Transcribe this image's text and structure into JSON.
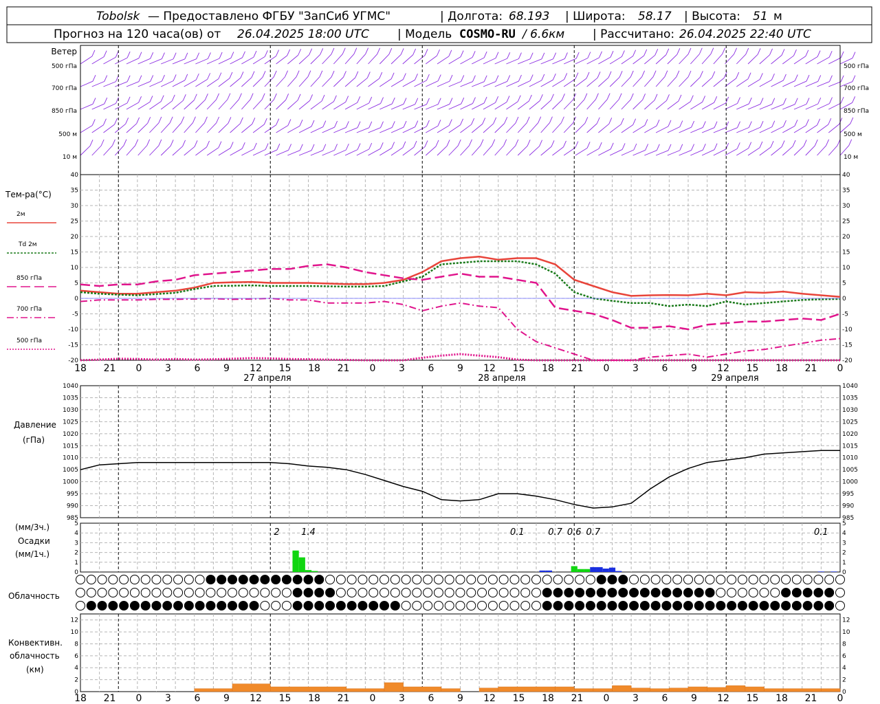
{
  "header": {
    "station": "Tobolsk",
    "line1_rest": "— Предоставлено ФГБУ \"ЗапСиб УГМС\"",
    "lon_label": "Долгота:",
    "lon_value": "68.193",
    "lat_label": "Широта:",
    "lat_value": "58.17",
    "alt_label": "Высота:",
    "alt_value": "51",
    "alt_unit": "м",
    "forecast_prefix": "Прогноз на 120 часа(ов) от",
    "forecast_start": "26.04.2025 18:00 UTC",
    "model_label": "Модель",
    "model_name": "COSMO-RU",
    "model_res": "/ 6.6км",
    "computed_label": "Рассчитано:",
    "computed_value": "26.04.2025 22:40 UTC"
  },
  "panels": {
    "wind": {
      "title": "Ветер",
      "levels": [
        "500 гПа",
        "700 гПа",
        "850 гПа",
        "500 м",
        "10 м"
      ],
      "color": "#8a2be2"
    },
    "temperature": {
      "title": "Тем-ра(°C)",
      "legend": [
        {
          "label": "2м",
          "color": "#e8443a",
          "style": "solid"
        },
        {
          "label": "Td 2м",
          "color": "#1a7a1a",
          "style": "dotted"
        },
        {
          "label": "850 гПа",
          "color": "#e0148c",
          "style": "solid"
        },
        {
          "label": "700 гПа",
          "color": "#e0148c",
          "style": "dash"
        },
        {
          "label": "500 гПа",
          "color": "#e0148c",
          "style": "dot"
        }
      ]
    },
    "pressure": {
      "title_line1": "Давление",
      "title_line2": "(гПа)"
    },
    "precip": {
      "units_top": "(мм/3ч.)",
      "title": "Осадки",
      "units_bottom": "(мм/1ч.)",
      "labels": [
        "2",
        "1.4",
        "0.1",
        "0.7",
        "0.6",
        "0.7",
        "0.1"
      ]
    },
    "cloud": {
      "title": "Облачность"
    },
    "convective": {
      "title_line1": "Конвективн.",
      "title_line2": "облачность",
      "title_line3": "(км)"
    }
  },
  "time_axis": {
    "ticks": [
      "18",
      "21",
      "0",
      "3",
      "6",
      "9",
      "12",
      "15",
      "18",
      "21",
      "0",
      "3",
      "6",
      "9",
      "12",
      "15",
      "18",
      "21",
      "0",
      "3",
      "6",
      "9",
      "12",
      "15",
      "18",
      "21",
      "0"
    ],
    "dates": [
      "27 апреля",
      "28 апреля",
      "29 апреля"
    ]
  },
  "colors": {
    "wind": "#8a2be2",
    "t2m": "#e8443a",
    "td": "#1a7a1a",
    "upper": "#e0148c",
    "precip_green": "#11d611",
    "precip_blue": "#1a2fe0",
    "conv": "#f08a2a"
  },
  "chart_data": [
    {
      "type": "line",
      "name": "temperature",
      "ylim": [
        -20,
        40
      ],
      "yticks": [
        -20,
        -15,
        -10,
        -5,
        0,
        5,
        10,
        15,
        20,
        25,
        30,
        35,
        40
      ],
      "x_hours": [
        0,
        3,
        6,
        9,
        12,
        15,
        18,
        21,
        24,
        27,
        30,
        33,
        36,
        39,
        42,
        45,
        48,
        51,
        54,
        57,
        60,
        63,
        66,
        69,
        72,
        75,
        78,
        81,
        84,
        87,
        90,
        93,
        96,
        99,
        102,
        105,
        108,
        111,
        114,
        117,
        120
      ],
      "series": [
        {
          "name": "2м",
          "values": [
            2.5,
            2,
            1.5,
            1.5,
            2,
            2.5,
            3.5,
            5,
            5.2,
            5.3,
            5,
            5,
            5,
            4.8,
            4.6,
            4.6,
            5,
            6,
            8.5,
            12,
            13,
            13.5,
            12.5,
            13,
            13,
            11,
            6,
            4,
            2,
            0.8,
            1,
            1.1,
            1,
            1.5,
            1,
            2,
            1.8,
            2.2,
            1.5,
            1,
            0.5
          ]
        },
        {
          "name": "Td 2м",
          "values": [
            2,
            1.5,
            1.2,
            1,
            1.4,
            1.8,
            3,
            4,
            4.1,
            4.2,
            4,
            4,
            4,
            3.9,
            3.8,
            3.8,
            4,
            5.5,
            7,
            11,
            11.5,
            12,
            12,
            12,
            11,
            8,
            2,
            0,
            -0.8,
            -1.5,
            -1.5,
            -2.5,
            -2,
            -2.5,
            -1,
            -2,
            -1.5,
            -1,
            -0.5,
            -0.3,
            -0.2
          ]
        },
        {
          "name": "850 гПа",
          "values": [
            4.5,
            4,
            4.5,
            4.5,
            5.5,
            6,
            7.5,
            8,
            8.5,
            9,
            9.5,
            9.5,
            10.5,
            11,
            10,
            8.5,
            7.5,
            6.5,
            6,
            7,
            8,
            7,
            7,
            6,
            5,
            -3,
            -4,
            -5,
            -7,
            -9.5,
            -9.5,
            -9,
            -10,
            -8.5,
            -8,
            -7.5,
            -7.5,
            -7,
            -6.5,
            -7,
            -5
          ]
        },
        {
          "name": "700 гПа",
          "values": [
            -1,
            -0.5,
            -0.5,
            -0.5,
            -0.3,
            -0.3,
            -0.2,
            -0.1,
            -0.3,
            -0.2,
            0,
            -0.5,
            -0.5,
            -1.5,
            -1.5,
            -1.5,
            -1,
            -2,
            -4,
            -2.5,
            -1.5,
            -2.5,
            -3,
            -10,
            -14,
            -16,
            -18,
            -20,
            -21,
            -20.5,
            -19,
            -18.5,
            -18,
            -19,
            -18,
            -17,
            -16.5,
            -15.5,
            -14.5,
            -13.5,
            -13
          ]
        },
        {
          "name": "500 гПа",
          "values": [
            -21,
            -19.8,
            -19.5,
            -19.6,
            -19.8,
            -19.6,
            -19.8,
            -19.7,
            -19.5,
            -19.3,
            -19.4,
            -19.6,
            -19.7,
            -19.8,
            -19.9,
            -20,
            -21,
            -20,
            -19.2,
            -18.5,
            -18,
            -18.5,
            -19,
            -19.8,
            -20,
            -20.5,
            -21,
            -21,
            -21,
            -21,
            -21,
            -21,
            -21,
            -21,
            -21,
            -21,
            -21,
            -21,
            -21,
            -21,
            -21
          ]
        }
      ]
    },
    {
      "type": "line",
      "name": "pressure",
      "ylim": [
        985,
        1040
      ],
      "yticks": [
        985,
        990,
        995,
        1000,
        1005,
        1010,
        1015,
        1020,
        1025,
        1030,
        1035,
        1040
      ],
      "x_hours": [
        0,
        3,
        6,
        9,
        12,
        15,
        18,
        21,
        24,
        27,
        30,
        33,
        36,
        39,
        42,
        45,
        48,
        51,
        54,
        57,
        60,
        63,
        66,
        69,
        72,
        75,
        78,
        81,
        84,
        87,
        90,
        93,
        96,
        99,
        102,
        105,
        108,
        111,
        114,
        117,
        120
      ],
      "values": [
        1005,
        1007,
        1007.5,
        1008,
        1008,
        1008,
        1008,
        1008,
        1008,
        1008,
        1008,
        1007.5,
        1006.5,
        1006,
        1005,
        1003,
        1000.5,
        998,
        996,
        992.5,
        992,
        992.5,
        995,
        995,
        994,
        992.5,
        990.5,
        989,
        989.5,
        991,
        997,
        1002,
        1005.5,
        1008,
        1009,
        1010,
        1011.5,
        1012,
        1012.5,
        1013,
        1013
      ]
    },
    {
      "type": "bar",
      "name": "precipitation",
      "ylim": [
        0,
        5
      ],
      "yticks": [
        0,
        1,
        2,
        3,
        4,
        5
      ],
      "bars": [
        {
          "hour": 34,
          "value": 2.2,
          "color": "green"
        },
        {
          "hour": 35,
          "value": 1.5,
          "color": "green"
        },
        {
          "hour": 36,
          "value": 0.2,
          "color": "green"
        },
        {
          "hour": 37,
          "value": 0.1,
          "color": "green"
        },
        {
          "hour": 73,
          "value": 0.15,
          "color": "blue"
        },
        {
          "hour": 74,
          "value": 0.15,
          "color": "blue"
        },
        {
          "hour": 78,
          "value": 0.6,
          "color": "green"
        },
        {
          "hour": 79,
          "value": 0.3,
          "color": "green"
        },
        {
          "hour": 80,
          "value": 0.3,
          "color": "green"
        },
        {
          "hour": 81,
          "value": 0.5,
          "color": "blue"
        },
        {
          "hour": 82,
          "value": 0.5,
          "color": "blue"
        },
        {
          "hour": 83,
          "value": 0.35,
          "color": "blue"
        },
        {
          "hour": 84,
          "value": 0.45,
          "color": "blue"
        },
        {
          "hour": 85,
          "value": 0.1,
          "color": "blue"
        },
        {
          "hour": 117,
          "value": 0.05,
          "color": "blue"
        },
        {
          "hour": 119,
          "value": 0.05,
          "color": "blue"
        }
      ],
      "labels": [
        {
          "hour": 31,
          "text": "2"
        },
        {
          "hour": 36,
          "text": "1.4"
        },
        {
          "hour": 69,
          "text": "0.1"
        },
        {
          "hour": 75,
          "text": "0.7"
        },
        {
          "hour": 78,
          "text": "0.6"
        },
        {
          "hour": 81,
          "text": "0.7"
        },
        {
          "hour": 117,
          "text": "0.1"
        }
      ]
    },
    {
      "type": "bar",
      "name": "convective",
      "ylim": [
        0,
        13
      ],
      "yticks": [
        0,
        2,
        4,
        6,
        8,
        10,
        12
      ],
      "bars": [
        {
          "from": 18,
          "to": 24,
          "value": 0.5
        },
        {
          "from": 24,
          "to": 30,
          "value": 1.3
        },
        {
          "from": 30,
          "to": 42,
          "value": 0.8
        },
        {
          "from": 42,
          "to": 48,
          "value": 0.5
        },
        {
          "from": 48,
          "to": 51,
          "value": 1.5
        },
        {
          "from": 51,
          "to": 57,
          "value": 0.8
        },
        {
          "from": 57,
          "to": 60,
          "value": 0.5
        },
        {
          "from": 63,
          "to": 66,
          "value": 0.6
        },
        {
          "from": 66,
          "to": 75,
          "value": 0.8
        },
        {
          "from": 75,
          "to": 78,
          "value": 0.8
        },
        {
          "from": 78,
          "to": 81,
          "value": 0.5
        },
        {
          "from": 81,
          "to": 84,
          "value": 0.5
        },
        {
          "from": 84,
          "to": 87,
          "value": 1.0
        },
        {
          "from": 87,
          "to": 90,
          "value": 0.6
        },
        {
          "from": 90,
          "to": 93,
          "value": 0.5
        },
        {
          "from": 93,
          "to": 96,
          "value": 0.6
        },
        {
          "from": 96,
          "to": 99,
          "value": 0.8
        },
        {
          "from": 99,
          "to": 102,
          "value": 0.7
        },
        {
          "from": 102,
          "to": 105,
          "value": 1.0
        },
        {
          "from": 105,
          "to": 108,
          "value": 0.8
        },
        {
          "from": 108,
          "to": 111,
          "value": 0.5
        },
        {
          "from": 111,
          "to": 117,
          "value": 0.5
        },
        {
          "from": 117,
          "to": 120,
          "value": 0.5
        }
      ]
    }
  ]
}
